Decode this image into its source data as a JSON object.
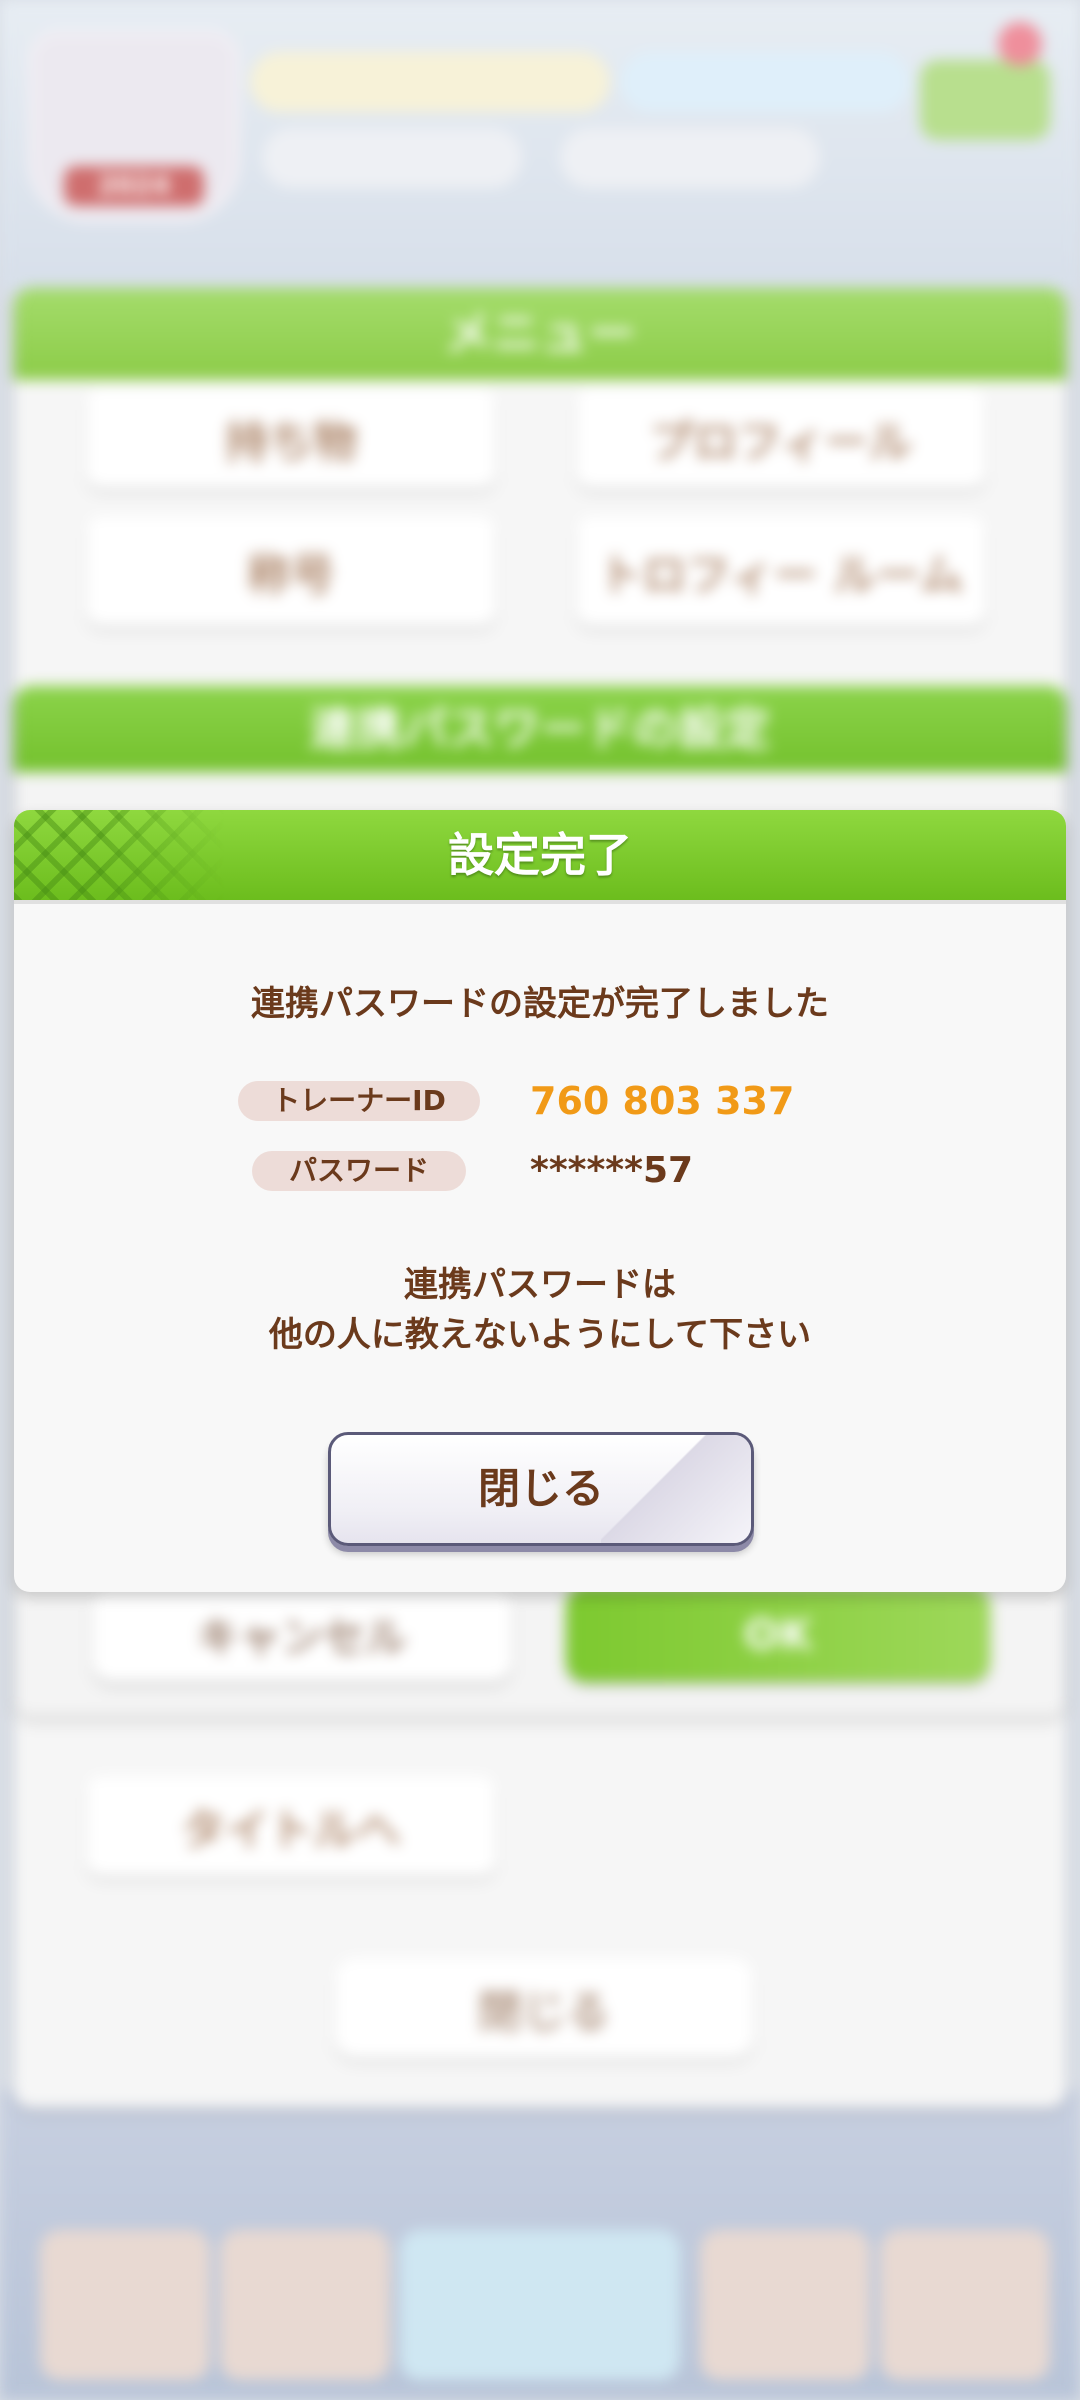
{
  "background": {
    "menu": {
      "title": "メニュー",
      "buttons": [
        "持ち物",
        "プロフィール",
        "称号",
        "トロフィー ルーム",
        "タイトルへ"
      ],
      "close_label": "閉じる"
    },
    "password_panel": {
      "title": "連携パスワードの設定",
      "cancel_label": "キャンセル",
      "ok_label": "OK"
    },
    "emblem_year": "2024"
  },
  "dialog": {
    "title": "設定完了",
    "message": "連携パスワードの設定が完了しました",
    "trainer_id_label": "トレーナーID",
    "trainer_id_value": "760 803 337",
    "password_label": "パスワード",
    "password_value": "******57",
    "warning_line1": "連携パスワードは",
    "warning_line2": "他の人に教えないようにして下さい",
    "close_label": "閉じる"
  },
  "colors": {
    "accent_green": "#6cbd1d",
    "text_brown": "#6b3a1c",
    "id_orange": "#f19a17",
    "pill_bg": "#eddcd8"
  }
}
